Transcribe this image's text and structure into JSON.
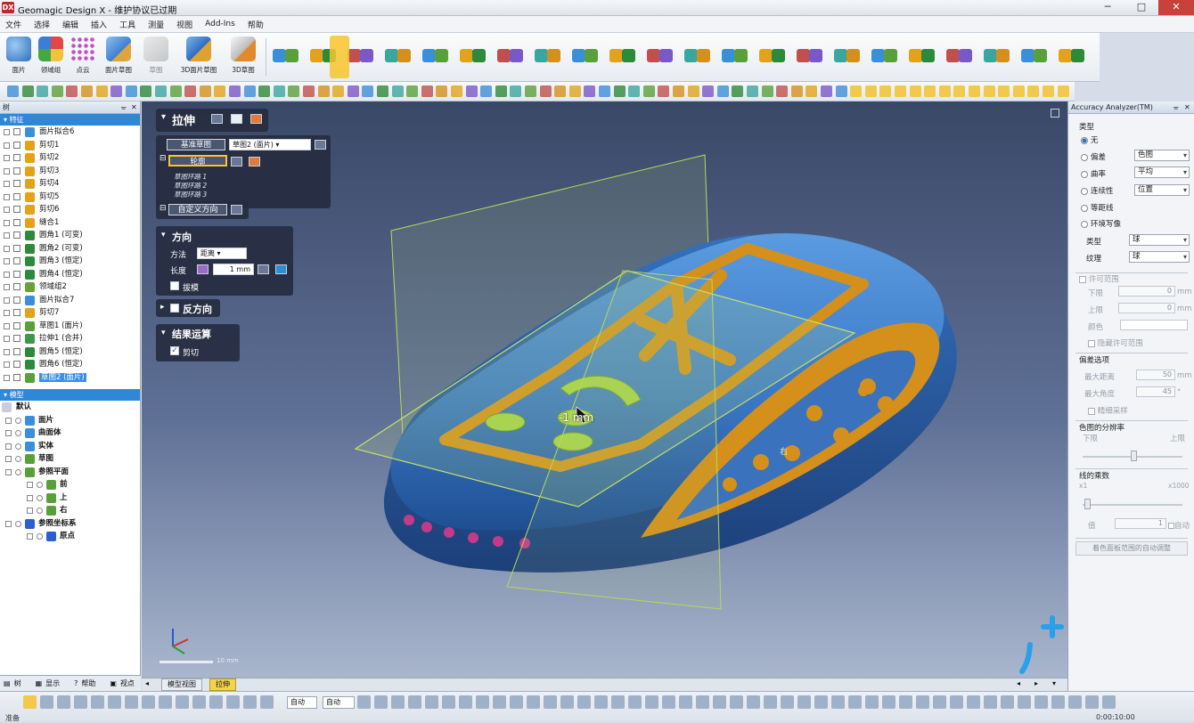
{
  "window": {
    "title": "Geomagic Design X - 维护协议已过期",
    "logo": "DX",
    "controls": [
      "minimize-icon",
      "maximize-icon",
      "close-icon"
    ]
  },
  "menu": [
    "文件",
    "选择",
    "编辑",
    "插入",
    "工具",
    "测量",
    "视图",
    "Add-Ins",
    "帮助"
  ],
  "ribbon": {
    "large_buttons": [
      "面片",
      "领域组",
      "点云",
      "面片草图",
      "草图",
      "3D面片草图",
      "3D草图"
    ]
  },
  "tree": {
    "panel_title": "树",
    "features_header": "特征",
    "features": [
      {
        "label": "面片拟合6",
        "icon": "fit-icon",
        "color": "#3b8fd8"
      },
      {
        "label": "剪切1",
        "icon": "cut-icon",
        "color": "#e2a21a"
      },
      {
        "label": "剪切2",
        "icon": "cut-icon",
        "color": "#e2a21a"
      },
      {
        "label": "剪切3",
        "icon": "cut-icon",
        "color": "#e2a21a"
      },
      {
        "label": "剪切4",
        "icon": "cut-icon",
        "color": "#e2a21a"
      },
      {
        "label": "剪切5",
        "icon": "cut-icon",
        "color": "#e2a21a"
      },
      {
        "label": "剪切6",
        "icon": "cut-icon",
        "color": "#e2a21a"
      },
      {
        "label": "缝合1",
        "icon": "sew-icon",
        "color": "#e2a21a"
      },
      {
        "label": "圆角1 (可变)",
        "icon": "fillet-icon",
        "color": "#2d8a3a"
      },
      {
        "label": "圆角2 (可变)",
        "icon": "fillet-icon",
        "color": "#2d8a3a"
      },
      {
        "label": "圆角3 (恒定)",
        "icon": "fillet-icon",
        "color": "#2d8a3a"
      },
      {
        "label": "圆角4 (恒定)",
        "icon": "fillet-icon",
        "color": "#2d8a3a"
      },
      {
        "label": "领域组2",
        "icon": "region-group-icon",
        "color": "#6aa03a"
      },
      {
        "label": "面片拟合7",
        "icon": "fit-icon",
        "color": "#3b8fd8"
      },
      {
        "label": "剪切7",
        "icon": "cut-icon",
        "color": "#e2a21a"
      },
      {
        "label": "草图1 (面片)",
        "icon": "sketch-icon",
        "color": "#5aa03a"
      },
      {
        "label": "拉伸1 (合并)",
        "icon": "extrude-icon",
        "color": "#3a9a4a"
      },
      {
        "label": "圆角5 (恒定)",
        "icon": "fillet-icon",
        "color": "#2d8a3a"
      },
      {
        "label": "圆角6 (恒定)",
        "icon": "fillet-icon",
        "color": "#2d8a3a"
      },
      {
        "label": "草图2 (面片)",
        "icon": "sketch-icon",
        "color": "#5aa03a",
        "selected": true
      }
    ],
    "model_header": "模型",
    "model": [
      {
        "label": "默认",
        "level": 0,
        "icon": "",
        "color": ""
      },
      {
        "label": "面片",
        "level": 1,
        "icon": "mesh-icon",
        "color": "#3b8fd8"
      },
      {
        "label": "曲面体",
        "level": 1,
        "icon": "surface-body-icon",
        "color": "#3b8fd8"
      },
      {
        "label": "实体",
        "level": 1,
        "icon": "solid-icon",
        "color": "#3b8fd8"
      },
      {
        "label": "草图",
        "level": 1,
        "icon": "sketch-icon",
        "color": "#5aa03a"
      },
      {
        "label": "参照平面",
        "level": 1,
        "icon": "ref-plane-icon",
        "color": "#5aa03a"
      },
      {
        "label": "前",
        "level": 2,
        "icon": "plane-icon",
        "color": "#5aa03a"
      },
      {
        "label": "上",
        "level": 2,
        "icon": "plane-icon",
        "color": "#5aa03a"
      },
      {
        "label": "右",
        "level": 2,
        "icon": "plane-icon",
        "color": "#5aa03a"
      },
      {
        "label": "参照坐标系",
        "level": 1,
        "icon": "ref-coord-icon",
        "color": "#2b5fd0"
      },
      {
        "label": "原点",
        "level": 2,
        "icon": "origin-icon",
        "color": "#2b5fd0"
      }
    ],
    "tabs": [
      "树",
      "显示",
      "帮助",
      "视点"
    ]
  },
  "feature_panel": {
    "title": "拉伸",
    "base_sketch_label": "基准草图",
    "base_sketch_value": "草图2 (面片)",
    "profile_label": "轮廓",
    "profile_items": [
      "草图环路 1",
      "草图环路 2",
      "草图环路 3"
    ],
    "custom_direction": "自定义方向",
    "direction": {
      "title": "方向",
      "method_label": "方法",
      "method_value": "距离",
      "length_label": "长度",
      "length_value": "1 mm",
      "draft_label": "拔模"
    },
    "reverse": {
      "title": "反方向"
    },
    "result": {
      "title": "结果运算",
      "cut_label": "剪切",
      "cut_checked": true
    }
  },
  "viewport": {
    "dimension_label": "-1 mm",
    "plane_label": "右",
    "scale_label": "10 mm",
    "tabs": [
      "模型视图",
      "拉伸"
    ]
  },
  "analyzer": {
    "title": "Accuracy Analyzer(TM)",
    "type_header": "类型",
    "none": "无",
    "deviation": "偏差",
    "deviation_value": "色图",
    "curvature": "曲率",
    "curvature_value": "平均",
    "continuity": "连续性",
    "continuity_value": "位置",
    "isoline": "等距线",
    "env_map": "环境写像",
    "kind_label": "类型",
    "kind_value": "球",
    "texture_label": "纹理",
    "texture_value": "球",
    "allow_range": "许可范围",
    "lower": "下限",
    "lower_value": "0",
    "upper": "上限",
    "upper_value": "0",
    "color": "颜色",
    "unit": "mm",
    "hide_range": "隐藏许可范围",
    "dev_options": "偏差选项",
    "max_dist": "最大距离",
    "max_dist_value": "50",
    "max_angle": "最大角度",
    "max_angle_value": "45",
    "deg": "°",
    "fine_sample": "精细采样",
    "resolution": "色图的分辨率",
    "res_low": "下限",
    "res_high": "上限",
    "multiplier": "线的乘数",
    "mult_min": "x1",
    "mult_max": "x1000",
    "value_label": "值",
    "value": "1",
    "auto": "自动",
    "auto_adjust": "着色面板范围的自动调整"
  },
  "statusbar": {
    "dd1": "自动",
    "dd2": "自动",
    "left_text": "准备",
    "right_text": "0:00:10:00"
  },
  "colors": {
    "mesh_blue": "#3f7fd0",
    "feature_orange": "#d4901a",
    "accent_green": "#a5d24a",
    "highlight_yellow": "#f7c52c"
  }
}
